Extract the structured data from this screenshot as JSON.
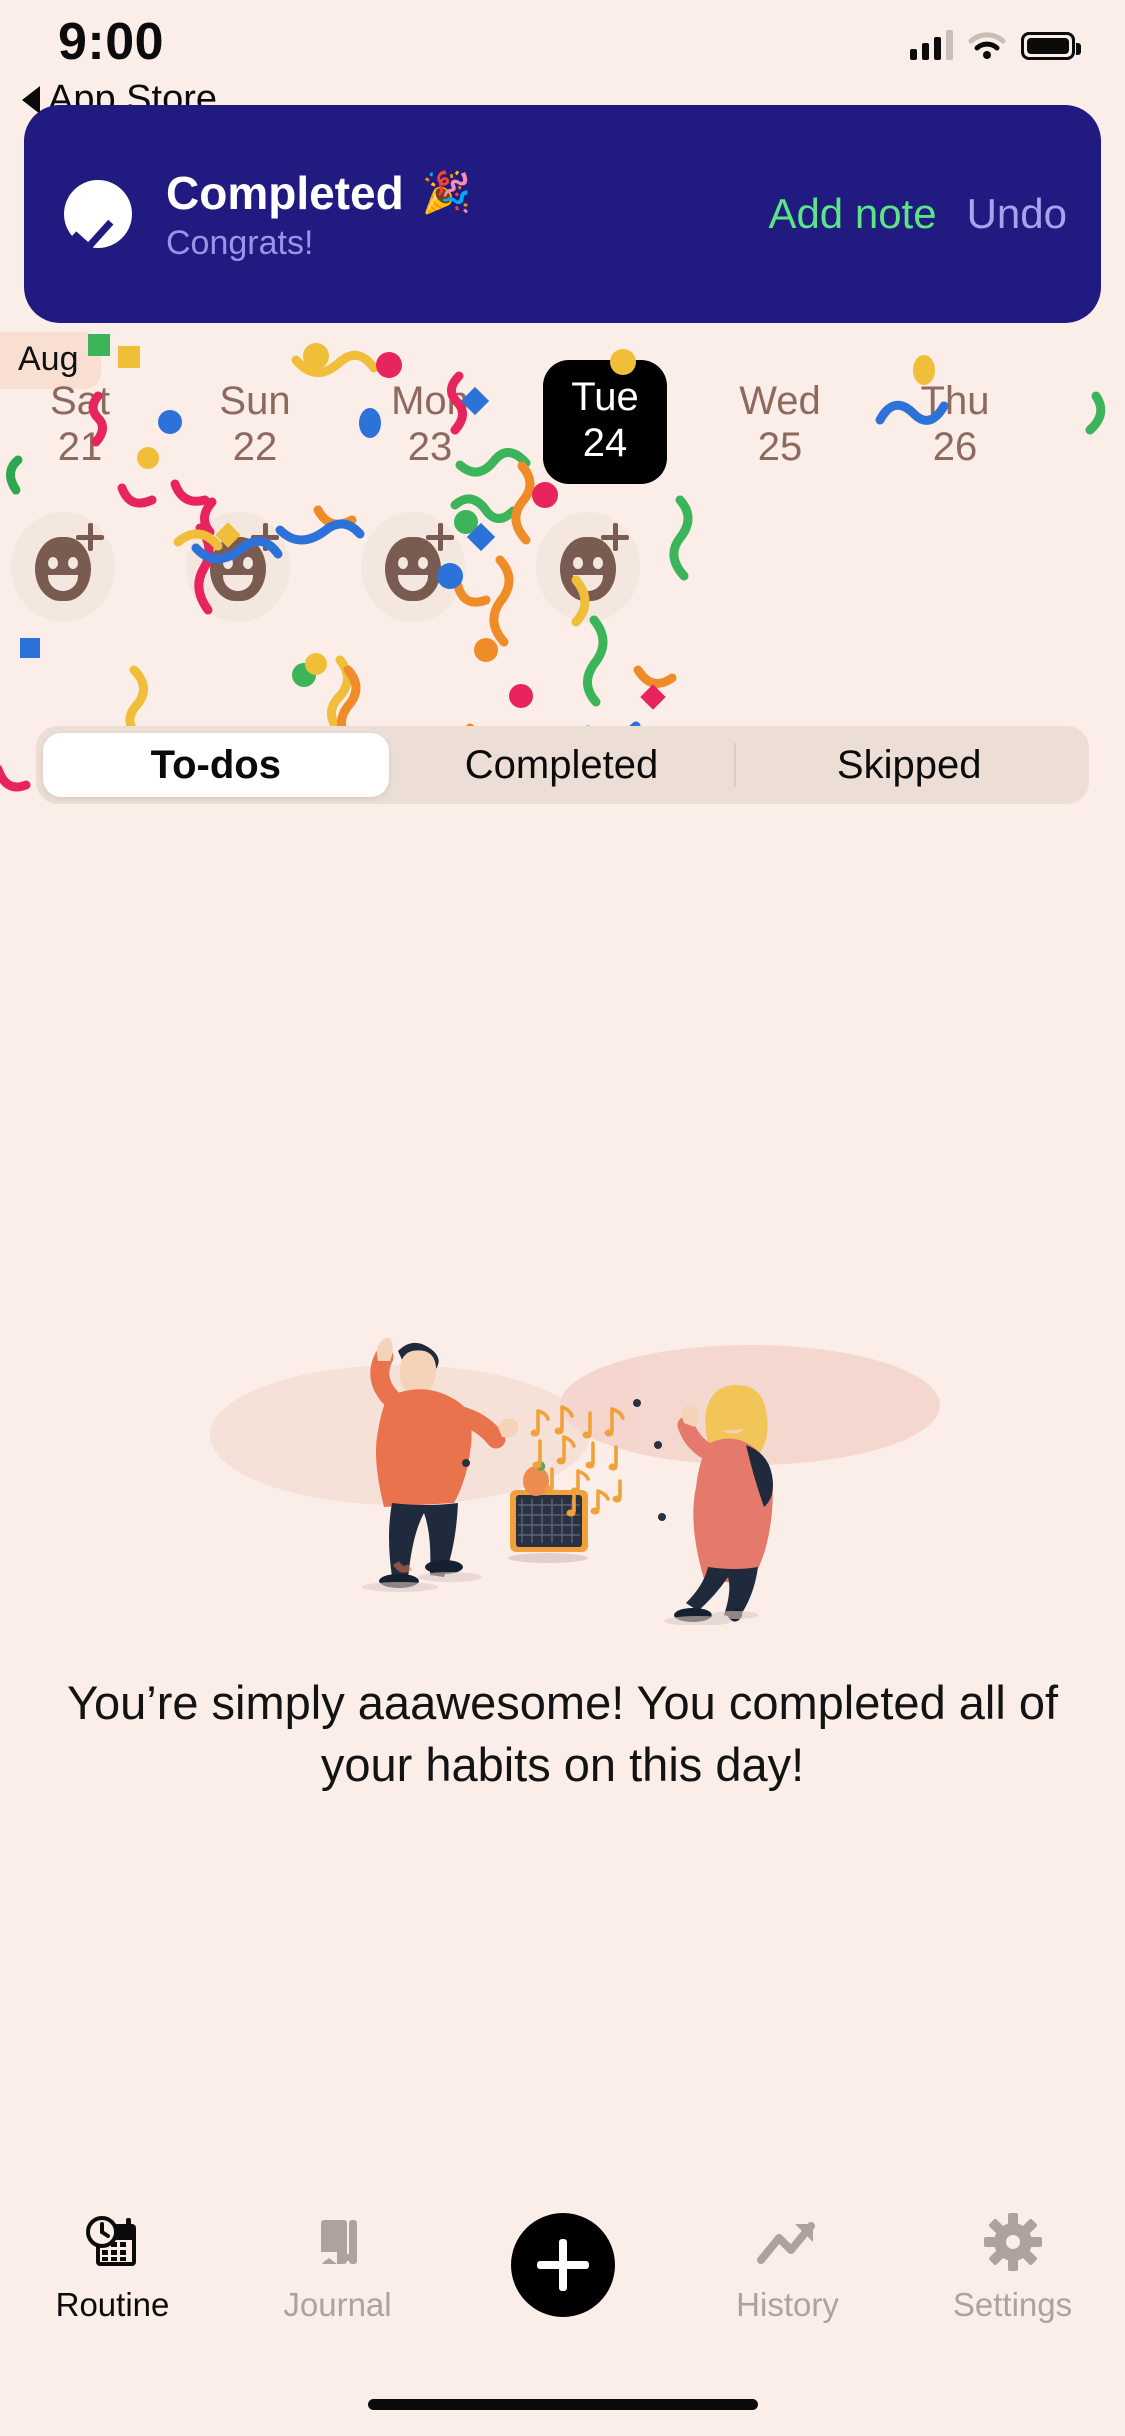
{
  "status_bar": {
    "time": "9:00",
    "back_label": "App Store",
    "icons": {
      "cellular": "signal-bars-icon",
      "wifi": "wifi-icon",
      "battery": "battery-icon"
    }
  },
  "banner": {
    "title": "Completed",
    "emoji": "🎉",
    "subtitle": "Congrats!",
    "add_note_label": "Add note",
    "undo_label": "Undo",
    "bg_color": "#211B81",
    "add_note_color": "#5BE585",
    "undo_color": "#A9A3EE",
    "check_icon": "check-circle-icon"
  },
  "calendar": {
    "month_label": "Aug",
    "days": [
      {
        "dow": "Sat",
        "num": "21",
        "selected": false
      },
      {
        "dow": "Sun",
        "num": "22",
        "selected": false
      },
      {
        "dow": "Mon",
        "num": "23",
        "selected": false
      },
      {
        "dow": "Tue",
        "num": "24",
        "selected": true
      },
      {
        "dow": "Wed",
        "num": "25",
        "selected": false
      },
      {
        "dow": "Thu",
        "num": "26",
        "selected": false
      }
    ],
    "selected_bg": "#000000",
    "day_color": "#8E6A5E"
  },
  "avatars": {
    "count": 4,
    "icon": "add-person-icon"
  },
  "tabs": {
    "items": [
      {
        "label": "To-dos",
        "active": true
      },
      {
        "label": "Completed",
        "active": false
      },
      {
        "label": "Skipped",
        "active": false
      }
    ],
    "track_color": "#EDDED5"
  },
  "empty_state": {
    "illustration": "two-people-dancing-to-music-illustration",
    "message": "You’re simply aaawesome! You completed all of your habits on this day!"
  },
  "bottom_nav": {
    "items": [
      {
        "label": "Routine",
        "icon": "calendar-clock-icon",
        "active": true
      },
      {
        "label": "Journal",
        "icon": "book-icon",
        "active": false
      },
      {
        "label": "",
        "icon": "plus-fab-icon",
        "active": false
      },
      {
        "label": "History",
        "icon": "trending-up-icon",
        "active": false
      },
      {
        "label": "Settings",
        "icon": "gear-icon",
        "active": false
      }
    ],
    "active_color": "#0B0B0B",
    "inactive_color": "#AFA29D"
  },
  "theme": {
    "background": "#FBEEE8",
    "month_badge_bg": "#F8DFD2"
  }
}
